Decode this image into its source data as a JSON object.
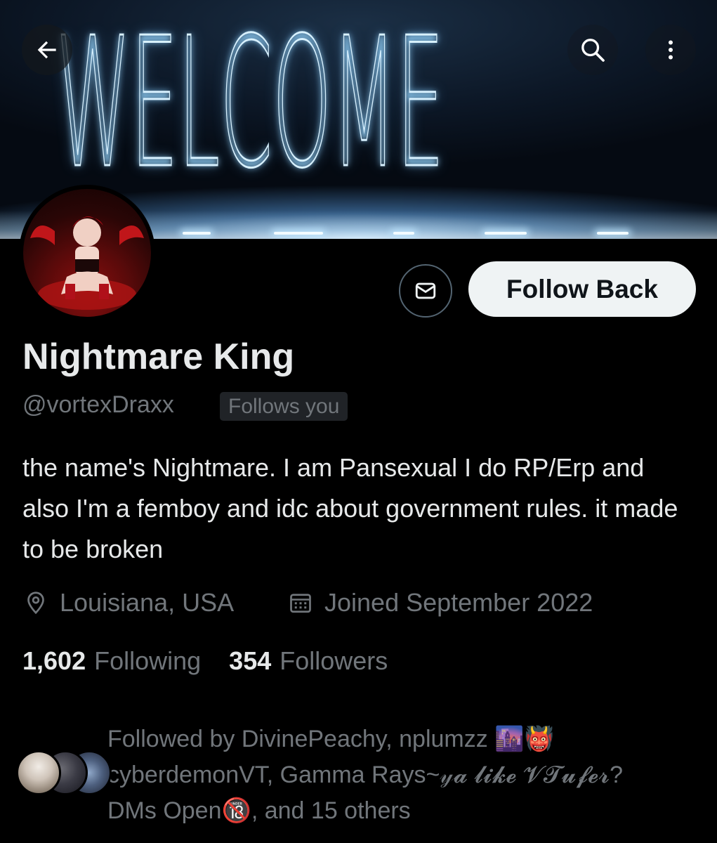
{
  "banner": {
    "letters": [
      "W",
      "E",
      "L",
      "C",
      "O",
      "M",
      "E"
    ]
  },
  "header": {
    "back_icon": "arrow-left-icon",
    "search_icon": "search-icon",
    "more_icon": "more-vertical-icon"
  },
  "actions": {
    "message_icon": "envelope-icon",
    "follow_label": "Follow Back"
  },
  "profile": {
    "name": "Nightmare King",
    "handle": "@vortexDraxx",
    "follows_you_badge": "Follows you",
    "bio": "the name's Nightmare. I am Pansexual I do RP/Erp and also I'm a femboy and idc about government rules. it made to be broken",
    "location": "Louisiana, USA",
    "location_icon": "location-pin-icon",
    "joined": "Joined September 2022",
    "joined_icon": "calendar-icon"
  },
  "stats": {
    "following_count": "1,602",
    "following_label": "Following",
    "followers_count": "354",
    "followers_label": "Followers"
  },
  "followed_by": {
    "prefix": "Followed by",
    "names": [
      "DivinePeachy, nplumzz 🌆👹",
      "cyberdemonVT, Gamma Rays~𝓎𝓪 𝓵𝓲𝓴𝓮 𝓥𝓣𝓾𝓯𝓮𝓻?",
      "DMs Open🔞"
    ],
    "suffix": ", and 15 others"
  },
  "colors": {
    "background": "#000000",
    "primary_text": "#e7e9ea",
    "secondary_text": "#71767b",
    "follow_button_bg": "#eff3f4",
    "follow_button_text": "#0f1419",
    "badge_bg": "#202327"
  }
}
